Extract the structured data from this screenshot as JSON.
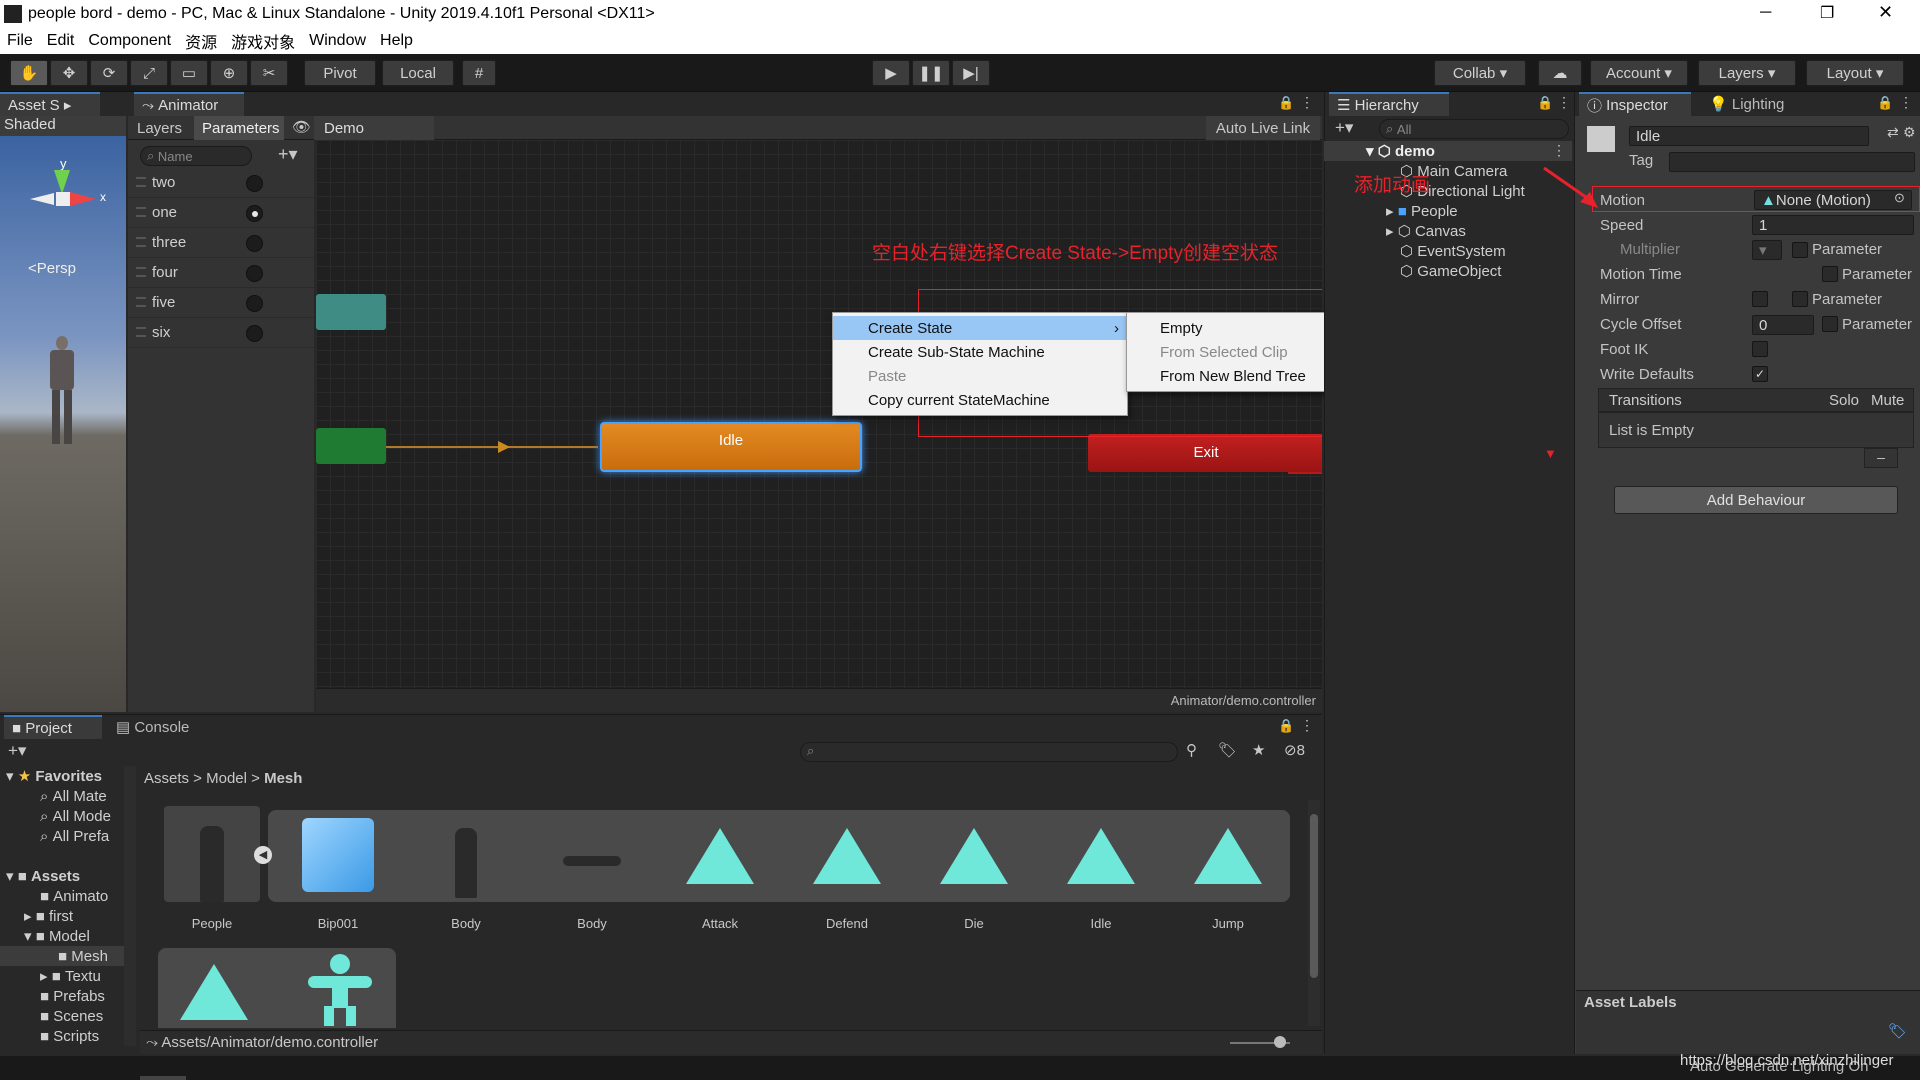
{
  "window": {
    "title": "people bord - demo - PC, Mac & Linux Standalone - Unity 2019.4.10f1 Personal <DX11>"
  },
  "menu": [
    "File",
    "Edit",
    "Component",
    "资源",
    "游戏对象",
    "Window",
    "Help"
  ],
  "toolbar": {
    "pivot": "Pivot",
    "local": "Local",
    "collab": "Collab",
    "account": "Account",
    "layers": "Layers",
    "layout": "Layout"
  },
  "scene": {
    "tab": "Asset S",
    "shading": "Shaded",
    "persp": "<Persp",
    "gizmo_y": "y",
    "gizmo_x": "x"
  },
  "animator": {
    "tab": "Animator",
    "layers_tab": "Layers",
    "params_tab": "Parameters",
    "breadcrumb": "Demo",
    "auto_live_link": "Auto Live Link",
    "search_placeholder": "Name",
    "parameters": [
      {
        "name": "two",
        "on": false
      },
      {
        "name": "one",
        "on": true
      },
      {
        "name": "three",
        "on": false
      },
      {
        "name": "four",
        "on": false
      },
      {
        "name": "five",
        "on": false
      },
      {
        "name": "six",
        "on": false
      }
    ],
    "states": {
      "idle": "Idle",
      "exit": "Exit"
    },
    "footer": "Animator/demo.controller",
    "annotation": "空白处右键选择Create State->Empty创建空状态"
  },
  "context_menu": {
    "items": [
      {
        "label": "Create State",
        "selected": true,
        "disabled": false
      },
      {
        "label": "Create Sub-State Machine",
        "selected": false,
        "disabled": false
      },
      {
        "label": "Paste",
        "selected": false,
        "disabled": true
      },
      {
        "label": "Copy current StateMachine",
        "selected": false,
        "disabled": false
      }
    ],
    "submenu": [
      {
        "label": "Empty",
        "disabled": false
      },
      {
        "label": "From Selected Clip",
        "disabled": true
      },
      {
        "label": "From New Blend Tree",
        "disabled": false
      }
    ]
  },
  "hierarchy": {
    "tab": "Hierarchy",
    "search_placeholder": "All",
    "root": "demo",
    "items": [
      "Main Camera",
      "Directional Light",
      "People",
      "Canvas",
      "EventSystem",
      "GameObject"
    ],
    "annotation": "添加动画"
  },
  "inspector": {
    "tab": "Inspector",
    "lighting_tab": "Lighting",
    "name": "Idle",
    "tag_label": "Tag",
    "motion_label": "Motion",
    "motion_value": "None (Motion)",
    "speed_label": "Speed",
    "speed_value": "1",
    "multiplier_label": "Multiplier",
    "parameter_label": "Parameter",
    "motion_time_label": "Motion Time",
    "mirror_label": "Mirror",
    "cycle_offset_label": "Cycle Offset",
    "cycle_offset_value": "0",
    "foot_ik_label": "Foot IK",
    "write_defaults_label": "Write Defaults",
    "transitions_label": "Transitions",
    "solo_label": "Solo",
    "mute_label": "Mute",
    "list_empty": "List is Empty",
    "add_behaviour": "Add Behaviour",
    "asset_labels": "Asset Labels",
    "footer_status": "Auto Generate Lighting On",
    "watermark": "https://blog.csdn.net/xinzhilinger"
  },
  "project": {
    "tab": "Project",
    "console_tab": "Console",
    "hidden_count": "8",
    "favorites_label": "Favorites",
    "favorites": [
      "All Mate",
      "All Mode",
      "All Prefa"
    ],
    "assets_label": "Assets",
    "folders": [
      "Animato",
      "first",
      "Model",
      "Mesh",
      "Textu",
      "Prefabs",
      "Scenes",
      "Scripts"
    ],
    "breadcrumb": [
      "Assets",
      "Model",
      "Mesh"
    ],
    "assets": [
      "People",
      "Bip001",
      "Body",
      "Body",
      "Attack",
      "Defend",
      "Die",
      "Idle",
      "Jump"
    ],
    "footer_path": "Assets/Animator/demo.controller"
  },
  "colors": {
    "accent": "#3a79bb",
    "idle_state": "#d97a12",
    "exit_state": "#b51a1a",
    "entry_state": "#1f7a32",
    "any_state": "#3f8c85",
    "annotation_red": "#e8222a",
    "clip_icon": "#6fe7d9"
  }
}
